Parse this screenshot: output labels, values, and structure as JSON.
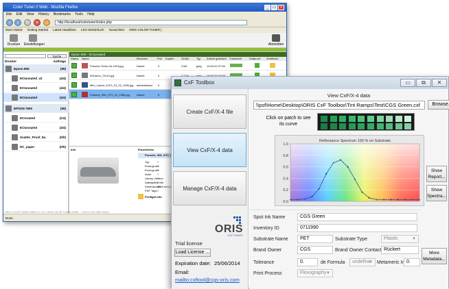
{
  "firefox": {
    "title": "Color Tuner // Web - Mozilla Firefox",
    "menu": [
      "Eile",
      "Edit",
      "View",
      "History",
      "Bookmarks",
      "Tools",
      "Help"
    ],
    "url": "http://localhost/colortuner/index.php",
    "bookmarks": [
      "Most Visited",
      "Getting Started",
      "Latest Headlines",
      "LEO Wörterbuch",
      "NovaClient",
      "ORIS COLOR TUNER |"
    ],
    "toolbar": {
      "print": "Drucken",
      "settings": "Einstellungen",
      "logout": "Abmelden"
    },
    "left": {
      "search_button": "Suche",
      "head_printer": "Drucker",
      "head_jobs": "Aufträge",
      "tree": [
        {
          "label": "Epson 800",
          "count": "(99)"
        },
        {
          "label": "ECIunoated_v2",
          "count": "(4/4)"
        },
        {
          "label": "ECIunoated",
          "count": "(4/4)"
        },
        {
          "label": "ECIunoated",
          "count": "(4/4)"
        },
        {
          "label": "EPSON 7900",
          "count": "(99)"
        },
        {
          "label": "ECIcoated",
          "count": "(1/4)"
        },
        {
          "label": "ECIunoated",
          "count": "(4/4)"
        },
        {
          "label": "Scatter_Proof_Ea",
          "count": "(0/0)"
        },
        {
          "label": "DC_paper",
          "count": "(0/0)"
        }
      ]
    },
    "main": {
      "header": "Epson 800 - ECIunoated",
      "columns": [
        "Status",
        "Name",
        "Benutzer",
        "Pos",
        "Kopien",
        "Größe",
        "Typ",
        "Zuletzt geändert",
        "Fortschritt",
        "Softproof",
        "Zertifiziert"
      ],
      "rows": [
        {
          "name": "Porsche-Turbo-04-1024.jpg",
          "user": "Daniel",
          "pos": "0",
          "size": "3 kB",
          "type": "jpeg",
          "date": "19.05.22 07:08"
        },
        {
          "name": "991turbo_70c12.jpg",
          "user": "Daniel",
          "pos": "0",
          "size": "2.7 kb",
          "type": "jpeg",
          "date": "19.05.22 07:08"
        },
        {
          "name": "Mini_Lancer_EVO_10_02_1280.jpg",
          "user": "administrator",
          "pos": "0",
          "size": "1.1 kb",
          "type": "jpeg",
          "date": "19.05.22 07:08"
        },
        {
          "name": "Porsche_996_GT2_01_1280.jpg",
          "user": "Daniel",
          "pos": "0",
          "size": "1.1 kb",
          "type": "jpeg",
          "date": "19.05.22 07:08"
        }
      ],
      "info_label": "Info",
      "details_label": "Einzelheiten",
      "details_name": "Porsche_996_GT2_01_1280.jpg",
      "details": [
        {
          "k": "Typ",
          "v": "?"
        },
        {
          "k": "Erzeugt am",
          "v": "?"
        },
        {
          "k": "Erzeugt am",
          "v": "?"
        },
        {
          "k": "Autor",
          "v": "?"
        },
        {
          "k": "Library Version",
          "v": "?"
        },
        {
          "k": "Dateigröße",
          "v": "2 Mb"
        },
        {
          "k": "Dimensionen",
          "v": "2815 mm x 2?"
        },
        {
          "k": "PDF Tags",
          "v": "?"
        }
      ],
      "preflight": "Preflight Info"
    },
    "status": "Done",
    "footer_text": "ORIS COLOR TUNER //WEB V.1.0.0.1   ORIS COLOR TUNER //WEB   ...   ©2013 CGS ORIS GmbH"
  },
  "cxf": {
    "title": "CxF Toolbox",
    "nav": [
      "Create CxF/X-4 file",
      "View CxF/X-4 data",
      "Manage CxF/X-4 data"
    ],
    "logo": "ORIS",
    "logo_sub": "SOFTWARE",
    "trial": "Trial license",
    "load_license": "Load License ...",
    "expiration_label": "Expiration date:",
    "expiration_value": "25/06/2014",
    "email_label": "Email:",
    "email": "mailto:cxftool@cgs-oris.com",
    "main_title": "View CxF/X-4 data",
    "path": "\\\\psf\\Home\\Desktop\\ORIS CxF Toolbox\\Tint Ramps\\Test\\CGS Green.cxf",
    "browse": "Browse...",
    "click_hint": "Click on patch to see its curve",
    "show_report": "Show Report...",
    "show_spectra": "Show Spectra...",
    "fields": {
      "spot_ink_name_label": "Spot Ink Name",
      "spot_ink_name": "CGS Green",
      "inventory_id_label": "Inventory ID",
      "inventory_id": "0711990",
      "substrate_name_label": "Substrate Name",
      "substrate_name": "PET",
      "substrate_type_label": "Substrate Type",
      "substrate_type": "Plastic",
      "brand_owner_label": "Brand Owner",
      "brand_owner": "CGS",
      "brand_owner_contact_label": "Brand Owner Contact",
      "brand_owner_contact": "Rückert",
      "tolerance_label": "Tolerance",
      "tolerance": "0.",
      "de_formula_label": "de Formula",
      "de_formula": "undefine",
      "metameric_label": "Metameric Index",
      "metameric": "0.",
      "print_process_label": "Print Process",
      "print_process": "Flexography",
      "more_metadata": "More Metadata..."
    },
    "patches_top": [
      "#1f8a4c",
      "#23a055",
      "#2bb061",
      "#36b96b",
      "#4cc37c",
      "#63cc8e",
      "#7dd5a1",
      "#9bdfb7",
      "#b7e8cb",
      "#d2f0de"
    ],
    "patches_bottom": [
      "#1c7a44",
      "#1e8448",
      "#228f4e",
      "#279856",
      "#2da15e",
      "#37aa68",
      "#44b374",
      "#55bc82",
      "#6bc592",
      "#86cfa6"
    ]
  },
  "chart_data": {
    "type": "line",
    "title": "Reflectance Spectrum 100 % on Substrate",
    "x": [
      380,
      400,
      420,
      440,
      460,
      480,
      500,
      520,
      540,
      560,
      580,
      600,
      620,
      640,
      660,
      680,
      700,
      720,
      740
    ],
    "values": [
      0.03,
      0.03,
      0.04,
      0.08,
      0.22,
      0.48,
      0.67,
      0.72,
      0.6,
      0.38,
      0.16,
      0.06,
      0.03,
      0.03,
      0.03,
      0.03,
      0.03,
      0.03,
      0.03
    ],
    "ylim": [
      0,
      1
    ],
    "yticks": [
      "0.0",
      "0.2",
      "0.4",
      "0.6",
      "0.8",
      "1.0"
    ],
    "line_color": "#1f3f8f"
  }
}
